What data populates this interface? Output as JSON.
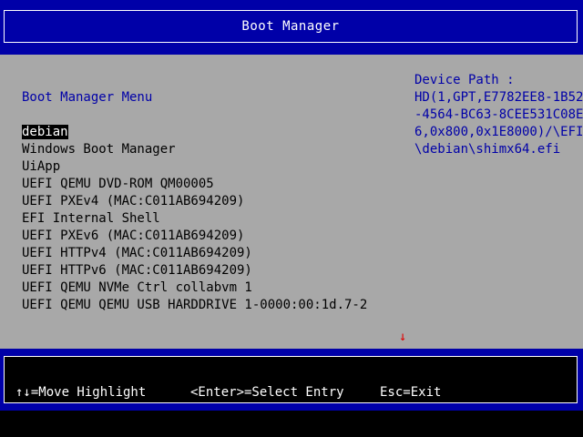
{
  "header": {
    "title": "Boot Manager"
  },
  "menu": {
    "title": "Boot Manager Menu",
    "entries": [
      {
        "label": "debian",
        "selected": true
      },
      {
        "label": "Windows Boot Manager"
      },
      {
        "label": "UiApp"
      },
      {
        "label": "UEFI QEMU DVD-ROM QM00005"
      },
      {
        "label": "UEFI PXEv4 (MAC:C011AB694209)"
      },
      {
        "label": "EFI Internal Shell"
      },
      {
        "label": "UEFI PXEv6 (MAC:C011AB694209)"
      },
      {
        "label": "UEFI HTTPv4 (MAC:C011AB694209)"
      },
      {
        "label": "UEFI HTTPv6 (MAC:C011AB694209)"
      },
      {
        "label": "UEFI QEMU NVMe Ctrl collabvm 1"
      },
      {
        "label": "UEFI QEMU QEMU USB HARDDRIVE 1-0000:00:1d.7-2"
      }
    ]
  },
  "device_path": {
    "label": "Device Path :",
    "lines": [
      "HD(1,GPT,E7782EE8-1B52",
      "-4564-BC63-8CEE531C08E",
      "6,0x800,0x1E8000)/\\EFI",
      "\\debian\\shimx64.efi"
    ]
  },
  "scroll_indicator": "↓",
  "footer": {
    "move": "↑↓=Move Highlight",
    "select": "<Enter>=Select Entry",
    "exit": "Esc=Exit"
  },
  "colors": {
    "band": "#0000a8",
    "panel": "#a8a8a8",
    "highlight_bg": "#000000",
    "highlight_fg": "#ffffff",
    "info_text": "#0000a8",
    "arrow": "#e00000"
  }
}
